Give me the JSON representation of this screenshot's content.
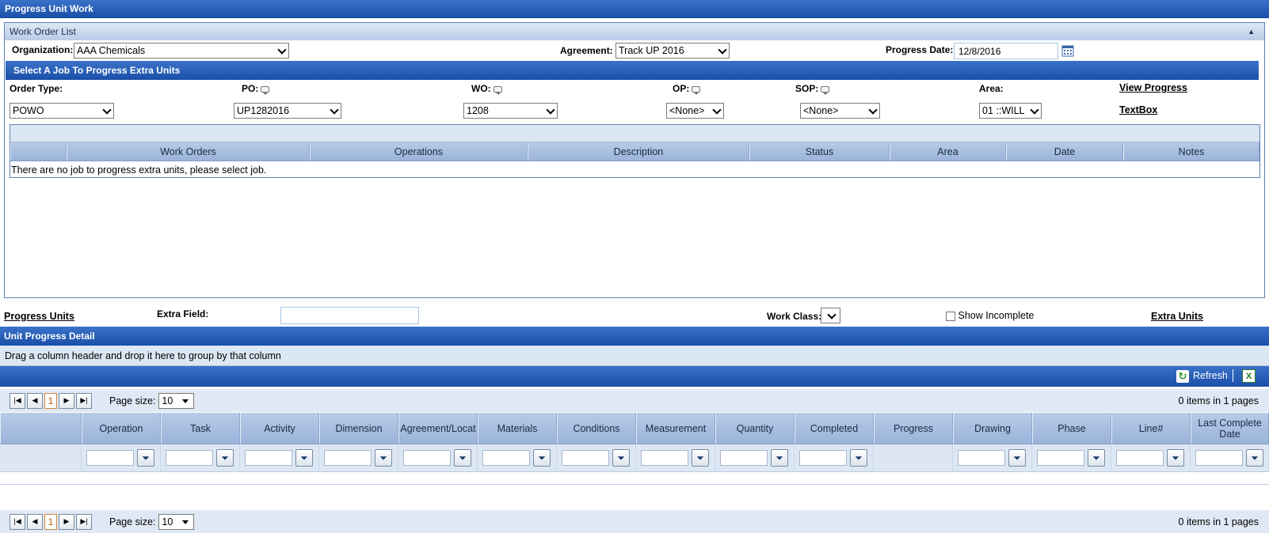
{
  "window_title": "Progress Unit Work",
  "work_order_list": {
    "header": "Work Order List",
    "organization_label": "Organization:",
    "organization_value": "AAA Chemicals",
    "agreement_label": "Agreement:",
    "agreement_value": "Track UP 2016",
    "progress_date_label": "Progress Date:",
    "progress_date_value": "12/8/2016"
  },
  "select_job": {
    "title": "Select A Job To Progress Extra Units",
    "order_type_label": "Order Type:",
    "po_label": "PO:",
    "wo_label": "WO:",
    "op_label": "OP:",
    "sop_label": "SOP:",
    "area_label": "Area:",
    "view_progress_link": "View Progress",
    "textbox_link": "TextBox",
    "order_type_value": "POWO",
    "po_value": "UP1282016",
    "wo_value": "1208",
    "op_value": "<None>",
    "sop_value": "<None>",
    "area_value": "01 ::WILL"
  },
  "job_grid": {
    "columns": [
      "",
      "Work Orders",
      "Operations",
      "Description",
      "Status",
      "Area",
      "Date",
      "Notes"
    ],
    "empty_message": "There are no job to progress extra units, please select job."
  },
  "progress_row": {
    "progress_units_link": "Progress Units",
    "extra_field_label": "Extra Field:",
    "extra_field_value": "",
    "work_class_label": "Work Class:",
    "work_class_value": "",
    "show_incomplete_label": "Show Incomplete",
    "extra_units_link": "Extra Units"
  },
  "unit_progress": {
    "title": "Unit Progress Detail",
    "group_hint": "Drag a column header and drop it here to group by that column",
    "refresh_label": "Refresh",
    "current_page": "1",
    "page_size_label": "Page size:",
    "page_size_value": "10",
    "items_info": "0 items in 1 pages",
    "columns": [
      "",
      "Operation",
      "Task",
      "Activity",
      "Dimension",
      "Agreement/Locat",
      "Materials",
      "Conditions",
      "Measurement",
      "Quantity",
      "Completed",
      "Progress",
      "Drawing",
      "Phase",
      "Line#",
      "Last Complete Date"
    ]
  },
  "colors": {
    "title_bar": "#1a4fa8",
    "panel_header": "#b9cbe6",
    "grid_header": "#9ab3da",
    "filter_row": "#dde7f4"
  }
}
